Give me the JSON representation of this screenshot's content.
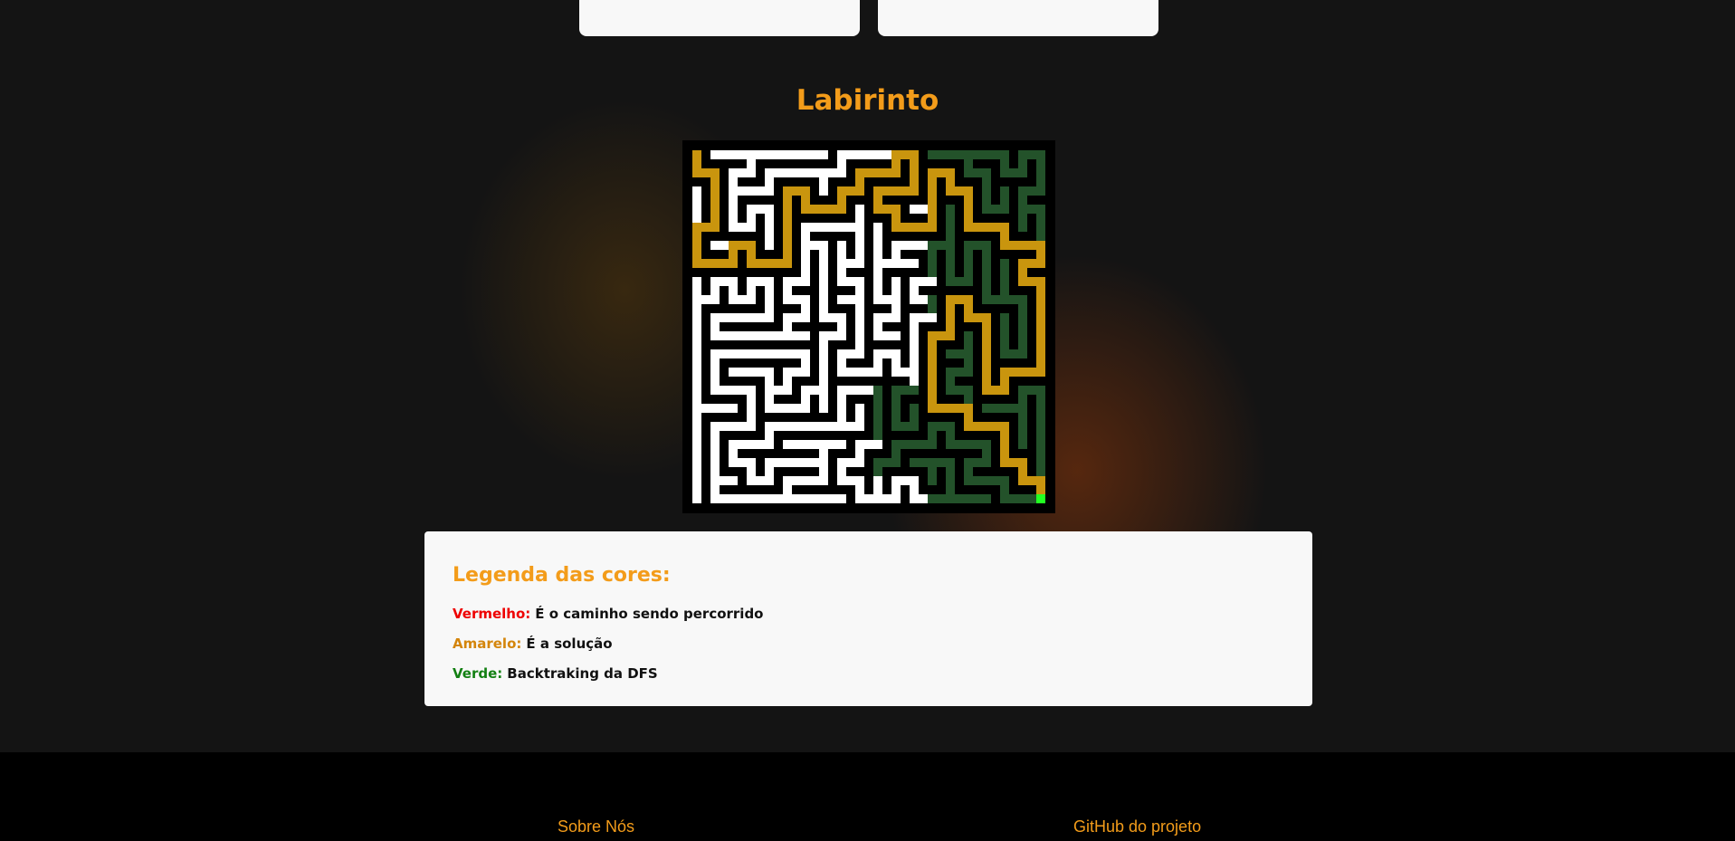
{
  "page": {
    "title": "Labirinto"
  },
  "maze": {
    "colors": {
      "wall": "#000000",
      "open": "#ffffff",
      "solution": "#c9950e",
      "backtrack": "#23522a",
      "goal": "#22ff22"
    }
  },
  "legend": {
    "title": "Legenda das cores:",
    "items": [
      {
        "key": "Vermelho:",
        "color": "#ee0000",
        "text": "É o caminho sendo percorrido"
      },
      {
        "key": "Amarelo:",
        "color": "#d4850b",
        "text": "É a solução"
      },
      {
        "key": "Verde:",
        "color": "#138013",
        "text": "Backtraking da DFS"
      }
    ]
  },
  "footer": {
    "about": "Sobre Nós",
    "github": "GitHub do projeto"
  }
}
